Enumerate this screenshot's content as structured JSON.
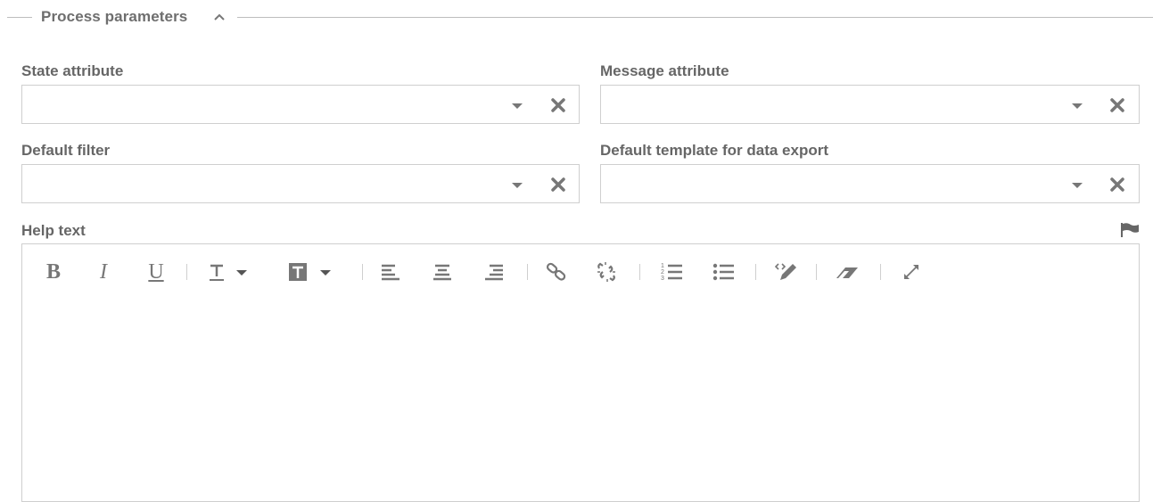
{
  "section": {
    "title": "Process parameters",
    "toggle_icon": "chevron-up-icon"
  },
  "fields": {
    "state_attribute": {
      "label": "State attribute",
      "value": ""
    },
    "message_attribute": {
      "label": "Message attribute",
      "value": ""
    },
    "default_filter": {
      "label": "Default filter",
      "value": ""
    },
    "default_template": {
      "label": "Default template for data export",
      "value": ""
    }
  },
  "help_text": {
    "label": "Help text",
    "flag_icon": "flag-icon",
    "content": "",
    "toolbar": {
      "bold_label": "B",
      "italic_label": "I",
      "underline_label": "U"
    }
  },
  "colors": {
    "text": "#6b6b6b",
    "border": "#cfcfcf",
    "icon": "#777777"
  }
}
